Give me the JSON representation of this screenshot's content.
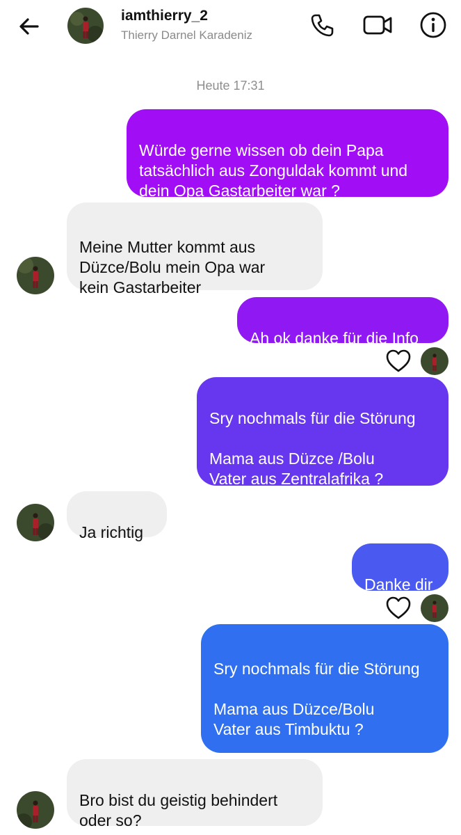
{
  "header": {
    "username": "iamthierry_2",
    "full_name": "Thierry Darnel Karadeniz",
    "icons": [
      "back-arrow-icon",
      "phone-icon",
      "video-camera-icon",
      "info-icon"
    ]
  },
  "thread": {
    "timestamp": "Heute 17:31",
    "messages": [
      {
        "from": "me",
        "text": "Würde gerne wissen ob dein Papa\ntatsächlich aus Zonguldak kommt und\ndein Opa Gastarbeiter war ?"
      },
      {
        "from": "them",
        "text": "Meine Mutter kommt aus\nDüzce/Bolu mein Opa war\nkein Gastarbeiter"
      },
      {
        "from": "me",
        "text": "Ah ok danke für die Info"
      },
      {
        "from": "me",
        "text": "Sry nochmals für die Störung\n\nMama aus Düzce /Bolu\nVater aus Zentralafrika ?"
      },
      {
        "from": "them",
        "text": "Ja richtig"
      },
      {
        "from": "me",
        "text": "Danke dir"
      },
      {
        "from": "me",
        "text": "Sry nochmals für die Störung\n\nMama aus Düzce/Bolu\nVater aus Timbuktu ?"
      },
      {
        "from": "them",
        "text": "Bro bist du geistig behindert\noder so?"
      }
    ]
  },
  "colors": {
    "gradient_top": "#a10df5",
    "gradient_bottom": "#2f6ff0",
    "incoming_bubble": "#efefef",
    "timestamp_text": "#8e8e8e"
  }
}
